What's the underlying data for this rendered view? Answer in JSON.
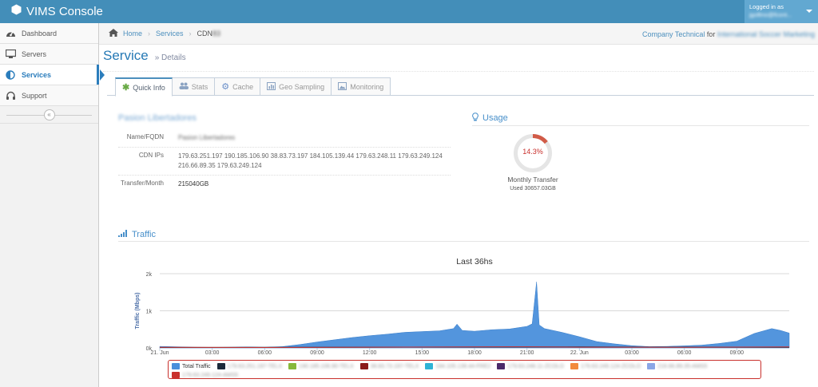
{
  "app": {
    "title": "VIMS Console"
  },
  "user": {
    "logged_in_label": "Logged in as",
    "name": "jgollino@fcont..."
  },
  "sidebar": {
    "items": [
      {
        "label": "Dashboard",
        "icon": "tachometer-icon",
        "active": false
      },
      {
        "label": "Servers",
        "icon": "desktop-icon",
        "active": false
      },
      {
        "label": "Services",
        "icon": "adjust-icon",
        "active": true
      },
      {
        "label": "Support",
        "icon": "headset-icon",
        "active": false
      }
    ],
    "collapse_glyph": "«"
  },
  "breadcrumb": {
    "home": "Home",
    "services": "Services",
    "current": "CDN",
    "current_suffix": "83",
    "company": "Company Technical",
    "for_label": "for",
    "client": "International Soccer Marketing"
  },
  "page": {
    "title": "Service",
    "subtitle": "» Details"
  },
  "tabs": [
    {
      "label": "Quick Info",
      "icon": "asterisk-icon",
      "active": true
    },
    {
      "label": "Stats",
      "icon": "group-icon",
      "active": false
    },
    {
      "label": "Cache",
      "icon": "cog-icon",
      "active": false
    },
    {
      "label": "Geo Sampling",
      "icon": "bar-chart-icon",
      "active": false
    },
    {
      "label": "Monitoring",
      "icon": "picture-icon",
      "active": false
    }
  ],
  "quick_info": {
    "title": "Pasion Libertadores",
    "rows": [
      {
        "label": "Name/FQDN",
        "value": "Pasion Libertadores"
      },
      {
        "label": "CDN IPs",
        "value": "179.63.251.197 190.185.106.90 38.83.73.197 184.105.139.44 179.63.248.11 179.63.249.124 216.66.89.35 179.63.249.124"
      },
      {
        "label": "Transfer/Month",
        "value": "215040GB"
      }
    ]
  },
  "usage": {
    "title": "Usage",
    "percent": 14.3,
    "percent_label": "14.3%",
    "label": "Monthly Transfer",
    "sub": "Used 30657.03GB",
    "colors": {
      "fill": "#d15b47",
      "track": "#e5e5e5"
    }
  },
  "traffic": {
    "title": "Traffic"
  },
  "chart_data": {
    "type": "area",
    "title": "Last 36hs",
    "ylabel": "Traffic (Mbps)",
    "xlabel": "",
    "ylim": [
      0,
      2000
    ],
    "y_ticks": [
      {
        "value": 0,
        "label": "0k"
      },
      {
        "value": 1000,
        "label": "1k"
      },
      {
        "value": 2000,
        "label": "2k"
      }
    ],
    "x_ticks": [
      "21. Jun",
      "03:00",
      "06:00",
      "09:00",
      "12:00",
      "15:00",
      "18:00",
      "21:00",
      "22. Jun",
      "03:00",
      "06:00",
      "09:00"
    ],
    "x_hours": [
      0,
      3,
      6,
      9,
      12,
      15,
      18,
      21,
      24,
      27,
      30,
      33
    ],
    "x_range": [
      0,
      36
    ],
    "grid": true,
    "legend_position": "bottom",
    "series": [
      {
        "name": "Total Traffic",
        "color": "#4a8fdb",
        "x": [
          0,
          1,
          2,
          3,
          4,
          5,
          6,
          7,
          8,
          9,
          10,
          11,
          12,
          13,
          14,
          15,
          16,
          16.8,
          17,
          17.3,
          18,
          19,
          20,
          21,
          21.3,
          21.55,
          21.7,
          22,
          23,
          24,
          25,
          26,
          27,
          28,
          29,
          30,
          31,
          32,
          33,
          34,
          35,
          35.5,
          36
        ],
        "values": [
          40,
          30,
          20,
          15,
          20,
          25,
          20,
          35,
          90,
          160,
          220,
          280,
          330,
          370,
          420,
          440,
          460,
          520,
          640,
          470,
          450,
          490,
          510,
          580,
          650,
          1780,
          620,
          520,
          420,
          300,
          170,
          110,
          60,
          35,
          40,
          55,
          75,
          120,
          180,
          390,
          520,
          470,
          400
        ]
      },
      {
        "name": "179.63.251.197-TELX",
        "color": "#1b2a3a",
        "x": [
          0,
          12,
          24,
          36
        ],
        "values": [
          10,
          20,
          25,
          15
        ]
      },
      {
        "name": "190.185.106.90-TELX",
        "color": "#87b83b"
      },
      {
        "name": "38.83.73.197-TELX",
        "color": "#8b1b1b"
      },
      {
        "name": "184.105.139.44-FRE2",
        "color": "#2fb3d6"
      },
      {
        "name": "179.63.248.11-ZCOLO",
        "color": "#4a2a6a"
      },
      {
        "name": "179.63.249.124-ZCOLO",
        "color": "#f28a3c"
      },
      {
        "name": "216.66.89.35-AMS5",
        "color": "#8aa6e6"
      },
      {
        "name": "179.63.249.124-AMS5",
        "color": "#c9302c",
        "x": [
          0,
          6,
          12,
          18,
          21,
          24,
          30,
          36
        ],
        "values": [
          15,
          10,
          20,
          25,
          30,
          20,
          15,
          25
        ]
      }
    ]
  }
}
